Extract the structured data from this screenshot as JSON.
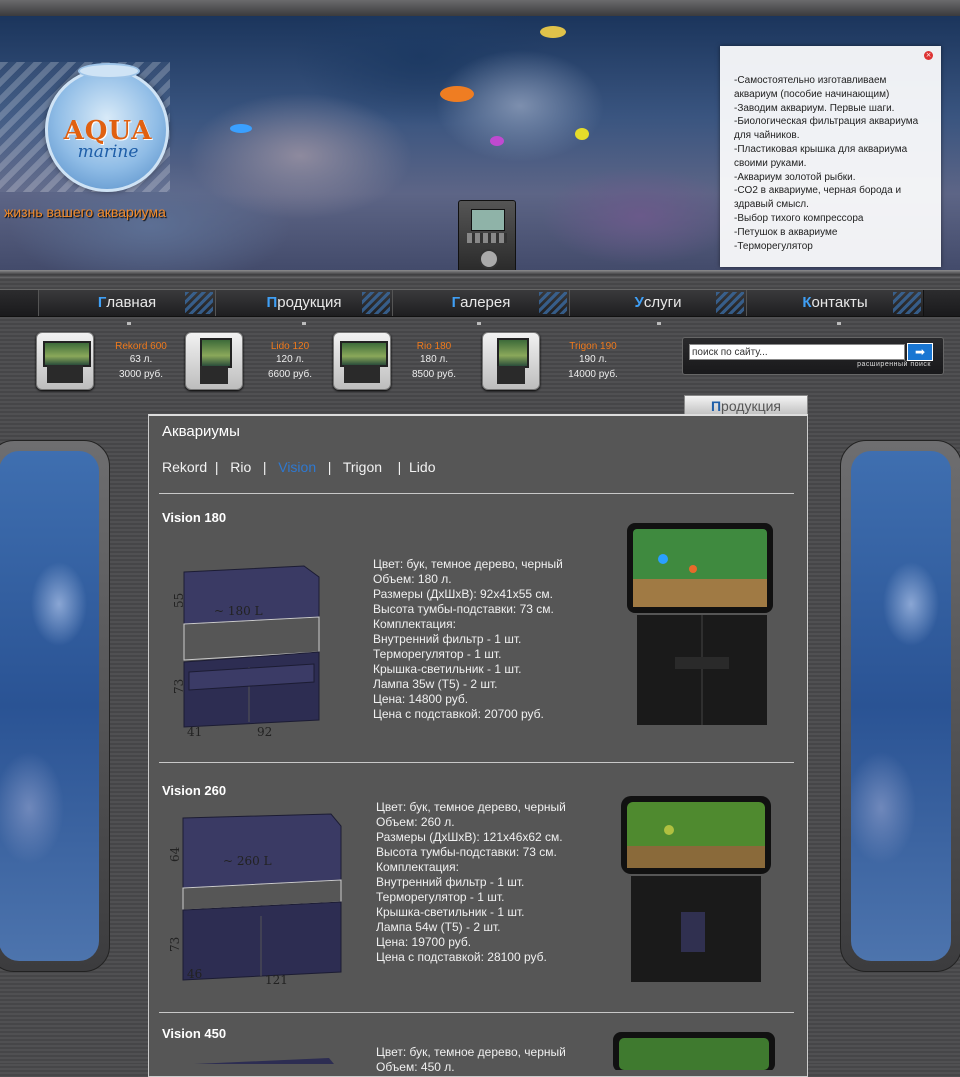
{
  "logo": {
    "aqua": "AQUA",
    "marine": "marine",
    "slogan": "жизнь вашего аквариума"
  },
  "news": [
    "-Самостоятельно изготавливаем аквариум (пособие начинающим)",
    "-Заводим аквариум. Первые шаги.",
    "-Биологическая фильтрация аквариума для чайников.",
    "-Пластиковая крышка для аквариума своими руками.",
    "-Аквариум золотой рыбки.",
    "-CO2 в аквариуме, черная борода и здравый смысл.",
    "-Выбор тихого компрессора",
    "-Петушок в аквариуме",
    "-Терморегулятор"
  ],
  "nav": [
    {
      "first": "Г",
      "rest": "лавная"
    },
    {
      "first": "П",
      "rest": "родукция"
    },
    {
      "first": "Г",
      "rest": "алерея"
    },
    {
      "first": "У",
      "rest": "слуги"
    },
    {
      "first": "К",
      "rest": "онтакты"
    }
  ],
  "products": [
    {
      "name": "Rekord 600",
      "volume": "63 л.",
      "price": "3000 руб."
    },
    {
      "name": "Lido 120",
      "volume": "120 л.",
      "price": "6600 руб."
    },
    {
      "name": "Rio 180",
      "volume": "180 л.",
      "price": "8500 руб."
    },
    {
      "name": "Trigon 190",
      "volume": "190 л.",
      "price": "14000 руб."
    }
  ],
  "search": {
    "placeholder": "поиск по сайту...",
    "value": "поиск по сайту...",
    "go": "➡",
    "advanced": "расширенный поиск"
  },
  "tab": {
    "first": "П",
    "rest": "родукция"
  },
  "content": {
    "title": "Аквариумы",
    "subnav": [
      "Rekord",
      "Rio",
      "Vision",
      "Trigon",
      "Lido"
    ],
    "subnav_active": "Vision",
    "models": [
      {
        "title": "Vision 180",
        "specs": [
          "Цвет: бук, темное дерево, черный",
          "Объем: 180 л.",
          "Размеры (ДхШхВ): 92x41x55 см.",
          "Высота тумбы-подставки: 73 см.",
          "Комплектация:",
          "Внутренний фильтр - 1 шт.",
          "Терморегулятор - 1 шт.",
          "Крышка-светильник - 1 шт.",
          "Лампа 35w (T5) - 2 шт.",
          "Цена: 14800 руб.",
          "Цена с подставкой: 20700 руб."
        ],
        "drawing": {
          "volume_label": "~ 180 L",
          "height": "55",
          "stand": "73",
          "depth": "41",
          "width": "92"
        }
      },
      {
        "title": "Vision 260",
        "specs": [
          "Цвет: бук, темное дерево, черный",
          "Объем: 260 л.",
          "Размеры (ДхШхВ): 121x46x62 см.",
          "Высота тумбы-подставки: 73 см.",
          "Комплектация:",
          "Внутренний фильтр - 1 шт.",
          "Терморегулятор - 1 шт.",
          "Крышка-светильник - 1 шт.",
          "Лампа 54w (T5) - 2 шт.",
          "Цена: 19700 руб.",
          "Цена с подставкой: 28100 руб."
        ],
        "drawing": {
          "volume_label": "~ 260 L",
          "height": "64",
          "stand": "73",
          "depth": "46",
          "width": "121"
        }
      },
      {
        "title": "Vision 450",
        "specs": [
          "Цвет: бук, темное дерево, черный",
          "Объем: 450 л."
        ]
      }
    ]
  },
  "colors": {
    "accent_orange": "#f07a1c",
    "accent_blue": "#2e78d0",
    "background": "#4b4b4d",
    "content_bg": "#565656"
  }
}
